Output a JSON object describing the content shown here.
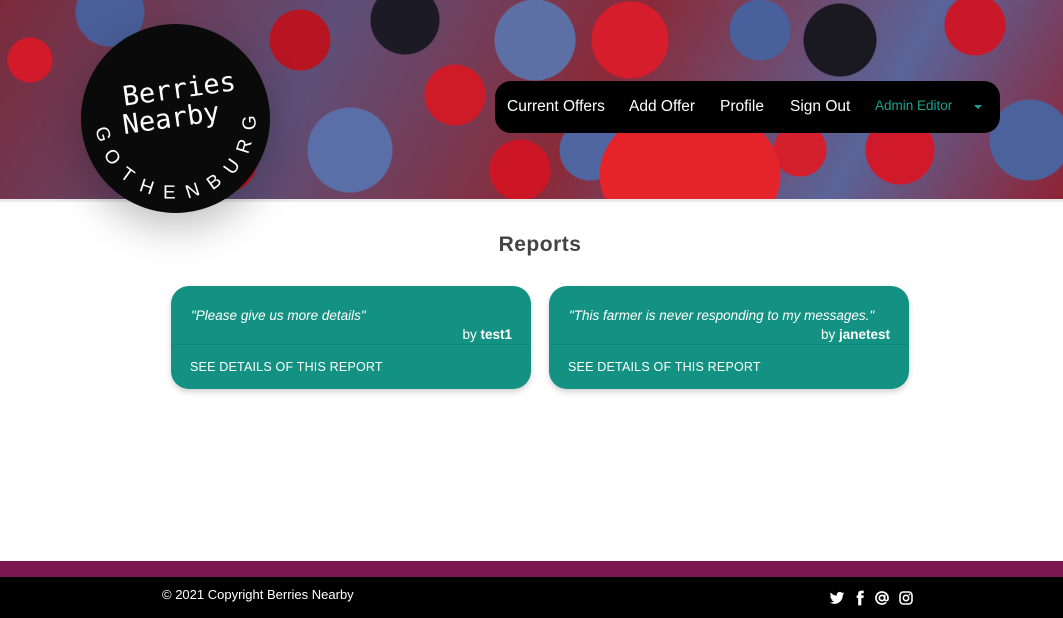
{
  "brand": {
    "title_line1": "Berries",
    "title_line2": "Nearby",
    "ring_text": "GOTHENBURG"
  },
  "nav": {
    "items": [
      {
        "label": "Current Offers"
      },
      {
        "label": "Add Offer"
      },
      {
        "label": "Profile"
      },
      {
        "label": "Sign Out"
      }
    ],
    "user_menu": {
      "label": "Admin Editor",
      "icon": "caret-down-icon"
    }
  },
  "main": {
    "title": "Reports",
    "reports": [
      {
        "quote": "\"Please give us more details\"",
        "by_prefix": "by",
        "author": "test1",
        "action": "SEE DETAILS OF THIS REPORT"
      },
      {
        "quote": "\"This farmer is never responding to my messages.\"",
        "by_prefix": "by",
        "author": "janetest",
        "action": "SEE DETAILS OF THIS REPORT"
      }
    ]
  },
  "footer": {
    "copyright": "© 2021 Copyright Berries Nearby",
    "social": [
      "twitter-icon",
      "facebook-icon",
      "email-icon",
      "instagram-icon"
    ]
  },
  "colors": {
    "card": "#139283",
    "accent": "#1aa08e",
    "footer_stripe": "#7b1650",
    "footer": "#000000"
  }
}
